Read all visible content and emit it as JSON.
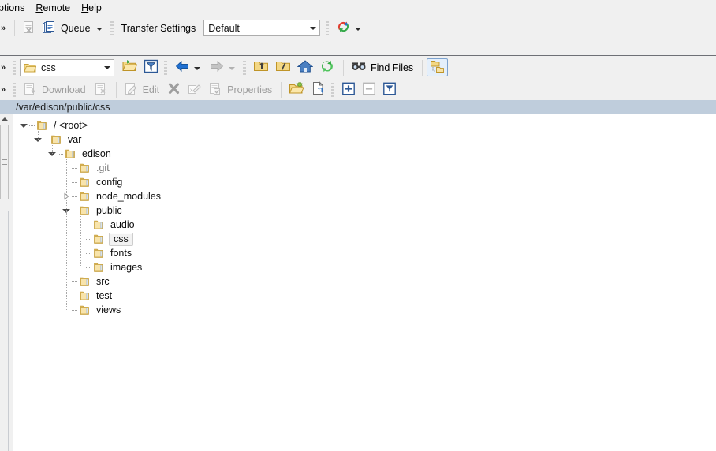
{
  "menu": {
    "items": [
      {
        "label": "ptions",
        "mnemonic": "",
        "clipped": true
      },
      {
        "label": "Remote",
        "mnemonic": "R"
      },
      {
        "label": "Help",
        "mnemonic": "H"
      }
    ]
  },
  "toolbar_queue": {
    "chevron": "»",
    "queue_label": "Queue",
    "transfer_settings_label": "Transfer Settings",
    "transfer_settings_value": "Default",
    "icons": {
      "queue_list": "queue-list-icon",
      "queue_docs": "queue-documents-icon",
      "session_color": "session-color-icon"
    }
  },
  "toolbar_path": {
    "chevron": "»",
    "current_dir": "css",
    "buttons": [
      {
        "name": "open-directory-icon",
        "label": "",
        "enabled": true
      },
      {
        "name": "filter-icon",
        "label": "",
        "enabled": true
      },
      {
        "name": "back-arrow-icon",
        "label": "",
        "enabled": true
      },
      {
        "name": "forward-arrow-icon",
        "label": "",
        "enabled": false
      },
      {
        "name": "parent-directory-icon",
        "label": "",
        "enabled": true
      },
      {
        "name": "root-directory-icon",
        "label": "",
        "enabled": true
      },
      {
        "name": "home-directory-icon",
        "label": "",
        "enabled": true
      },
      {
        "name": "refresh-icon",
        "label": "",
        "enabled": true
      },
      {
        "name": "find-files-icon",
        "label": "Find Files",
        "enabled": true
      },
      {
        "name": "directory-tree-toggle-icon",
        "label": "",
        "enabled": true,
        "selected": true
      }
    ]
  },
  "toolbar_file": {
    "chevron": "»",
    "download_label": "Download",
    "edit_label": "Edit",
    "properties_label": "Properties",
    "icons": {
      "download": "download-icon",
      "download_options": "download-options-icon",
      "edit": "edit-icon",
      "delete": "delete-x-icon",
      "rename": "rename-icon",
      "properties": "properties-icon",
      "new_directory": "new-directory-icon",
      "new_file": "new-file-icon",
      "select_add": "selection-add-icon",
      "select_remove": "selection-remove-icon",
      "select_filter": "selection-filter-icon"
    }
  },
  "pathbar": {
    "path": "/var/edison/public/css"
  },
  "tree": {
    "nodes": [
      {
        "label": "/ <root>",
        "depth": 0,
        "state": "expanded",
        "selected": false,
        "dim": false
      },
      {
        "label": "var",
        "depth": 1,
        "state": "expanded",
        "selected": false,
        "dim": false
      },
      {
        "label": "edison",
        "depth": 2,
        "state": "expanded",
        "selected": false,
        "dim": false
      },
      {
        "label": ".git",
        "depth": 3,
        "state": "leaf",
        "selected": false,
        "dim": true
      },
      {
        "label": "config",
        "depth": 3,
        "state": "leaf",
        "selected": false,
        "dim": false
      },
      {
        "label": "node_modules",
        "depth": 3,
        "state": "collapsed",
        "selected": false,
        "dim": false
      },
      {
        "label": "public",
        "depth": 3,
        "state": "expanded",
        "selected": false,
        "dim": false
      },
      {
        "label": "audio",
        "depth": 4,
        "state": "leaf",
        "selected": false,
        "dim": false
      },
      {
        "label": "css",
        "depth": 4,
        "state": "leaf",
        "selected": true,
        "dim": false
      },
      {
        "label": "fonts",
        "depth": 4,
        "state": "leaf",
        "selected": false,
        "dim": false
      },
      {
        "label": "images",
        "depth": 4,
        "state": "leaf",
        "selected": false,
        "dim": false
      },
      {
        "label": "src",
        "depth": 3,
        "state": "leaf",
        "selected": false,
        "dim": false
      },
      {
        "label": "test",
        "depth": 3,
        "state": "leaf",
        "selected": false,
        "dim": false
      },
      {
        "label": "views",
        "depth": 3,
        "state": "leaf",
        "selected": false,
        "dim": false
      }
    ]
  },
  "colors": {
    "toolbar_bg": "#f0f0f0",
    "pathbar_bg": "#bfcddc",
    "panel_bg": "#ffffff",
    "folder_yellow": "#f5d067",
    "selection_border": "#7da2ce",
    "selection_fill": "#e4effb",
    "rule": "#6e7076"
  }
}
